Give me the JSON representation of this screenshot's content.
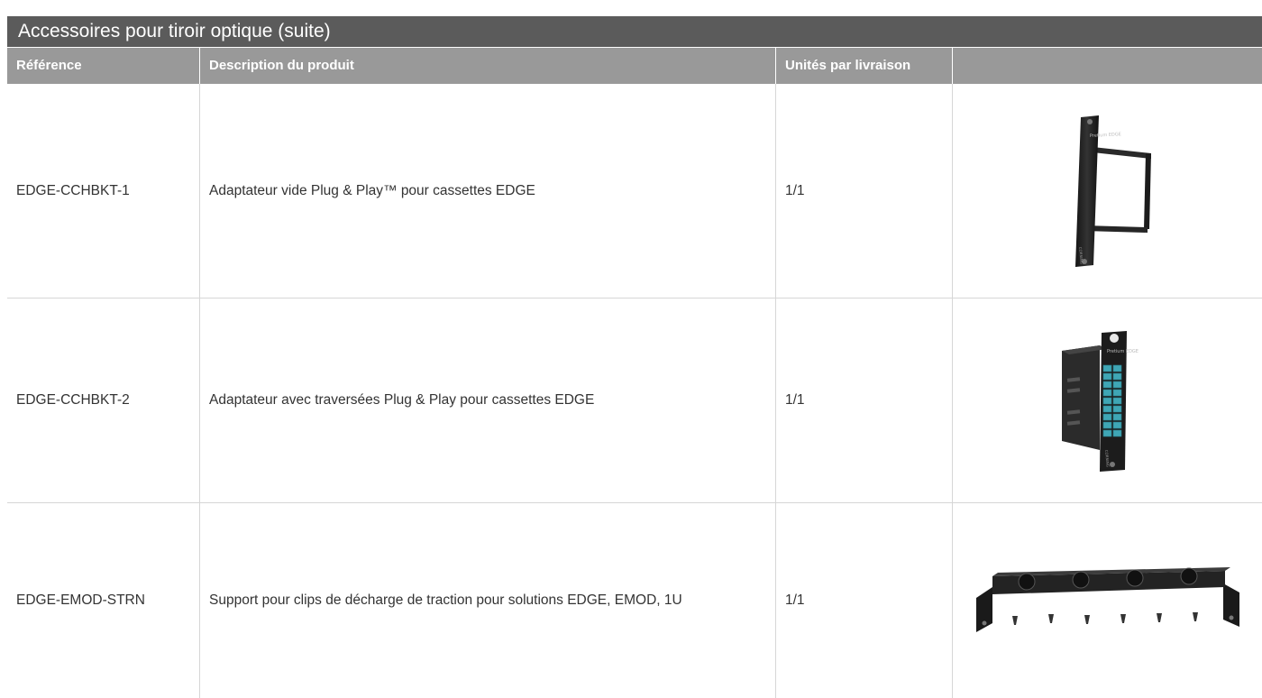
{
  "title": "Accessoires pour tiroir optique (suite)",
  "headers": {
    "reference": "Référence",
    "description": "Description du produit",
    "units": "Unités par livraison",
    "image": ""
  },
  "rows": [
    {
      "reference": "EDGE-CCHBKT-1",
      "description": "Adaptateur vide Plug & Play™ pour cassettes EDGE",
      "units": "1/1",
      "image_label": "Pretium EDGE",
      "image_brand": "CORNING"
    },
    {
      "reference": "EDGE-CCHBKT-2",
      "description": "Adaptateur avec traversées Plug & Play pour cassettes EDGE",
      "units": "1/1",
      "image_label": "Pretium EDGE",
      "image_brand": "CORNING"
    },
    {
      "reference": "EDGE-EMOD-STRN",
      "description": "Support pour clips de décharge de traction pour solutions EDGE, EMOD, 1U",
      "units": "1/1"
    }
  ],
  "colors": {
    "title_bg": "#5b5b5b",
    "header_bg": "#999999",
    "grid": "#d6d6d6",
    "adapter_ports": "#3fa6b5"
  }
}
